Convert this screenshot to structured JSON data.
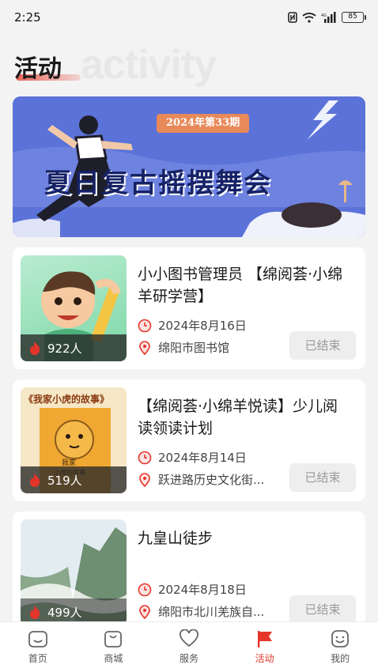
{
  "status_bar": {
    "time": "2:25",
    "battery": "85"
  },
  "header": {
    "title": "活动",
    "bg_word": "activity"
  },
  "banner": {
    "tag": "2024年第33期",
    "title": "夏日复古摇摆舞会"
  },
  "activities": [
    {
      "title": "小小图书管理员 【绵阅荟·小绵羊研学营】",
      "participants": "922人",
      "date": "2024年8月16日",
      "location": "绵阳市图书馆",
      "status": "已结束"
    },
    {
      "title": "【绵阅荟·小绵羊悦读】少儿阅读领读计划",
      "participants": "519人",
      "date": "2024年8月14日",
      "location": "跃进路历史文化街...",
      "status": "已结束",
      "thumb_text": "《我家小虎的故事》"
    },
    {
      "title": "九皇山徒步",
      "participants": "499人",
      "date": "2024年8月18日",
      "location": "绵阳市北川羌族自...",
      "status": "已结束"
    }
  ],
  "tabs": [
    {
      "label": "首页",
      "icon": "home-icon"
    },
    {
      "label": "商城",
      "icon": "shop-icon"
    },
    {
      "label": "服务",
      "icon": "heart-icon"
    },
    {
      "label": "活动",
      "icon": "flag-icon",
      "active": true
    },
    {
      "label": "我的",
      "icon": "profile-icon"
    }
  ],
  "colors": {
    "accent": "#e5352b",
    "banner_bg": "#5b72d8"
  }
}
